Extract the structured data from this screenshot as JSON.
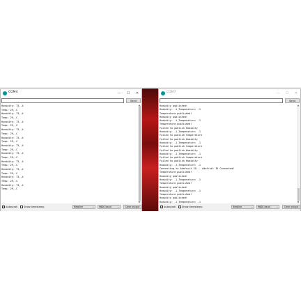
{
  "left_window": {
    "title": "COM4",
    "controls": [
      "—",
      "☐",
      "✕"
    ],
    "send_label": "Send",
    "input_value": "",
    "lines": [
      "Humidity: 73,.4",
      "Temp: 29,.C",
      "Humidity: 73,.4",
      "Temp: 29,.C",
      "Humidity: 73,.4",
      "Temp: 29,.C",
      "Humidity: 73,.4",
      "Temp: 29,.C",
      "Humidity: 73,.4",
      "Temp: 29,.C",
      "Humidity: 73,.4",
      "Temp: 29,.C",
      "Humidity: 73,.4",
      "Temp: 29,.C",
      "Humidity: 73,.4",
      "Temp: 29,.C",
      "Humidity: 73,.4",
      "Temp: 29,.C",
      "Humidity: 73,.4",
      "Temp: 29,.C",
      "Humidity: 73,.4",
      "Temp: 29,.C"
    ],
    "autoscroll_label": "Autoscroll",
    "autoscroll_checked": "✓",
    "timestamp_label": "Show timestamp",
    "line_ending": "Newline",
    "baud": "9600 baud",
    "clear_label": "Clear output"
  },
  "right_window": {
    "title": "COM7",
    "controls": [
      "—",
      "☐",
      "✕"
    ],
    "send_label": "Send",
    "input_value": "",
    "lines": [
      "Humidity published!",
      "Humidity: -1,Temperature: -1",
      "Temperature published!",
      "Humidity published!",
      "Humidity: -1,Temperature: -1",
      "Temperature published!",
      "Failed to publish Humidity",
      "Humidity: -1,Temperature: -1",
      "Failed to publish temperature",
      "Failed to publish Humidity",
      "Humidity: -1,Temperature: -1",
      "Failed to publish temperature",
      "Failed to publish Humidity",
      "Humidity: -1,Temperature: -1",
      "Failed to publish temperature",
      "Failed to publish Humidity",
      "Humidity: -1,Temperature: -1",
      "Connecting to Adafruit IO... Adafruit IO Connected!",
      "Temperature published!",
      "Humidity published!",
      "Humidity: -1,Temperature: -1",
      "Temperature published!",
      "Humidity published!",
      "Humidity: -1,Temperature: -1",
      "Temperature published!",
      "Humidity published!",
      "Humidity: -1,Temperature: -1"
    ],
    "autoscroll_label": "Autoscroll",
    "autoscroll_checked": "✓",
    "timestamp_label": "Show timestamp",
    "line_ending": "Newline",
    "baud": "9600 baud",
    "clear_label": "Clear output"
  }
}
